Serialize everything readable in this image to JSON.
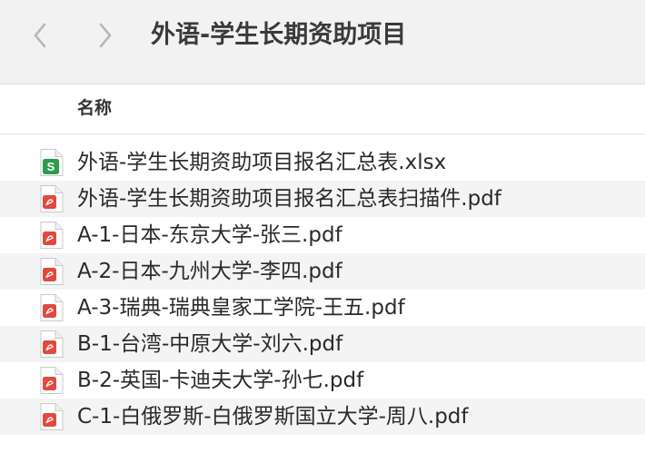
{
  "window": {
    "title": "外语-学生长期资助项目"
  },
  "navigation": {
    "back_icon": "chevron-left-icon",
    "forward_icon": "chevron-right-icon"
  },
  "columns": {
    "name": "名称"
  },
  "colors": {
    "toolbar_bg": "#f2f2f2",
    "row_alt_bg": "#f4f4f4",
    "xlsx_icon_accent": "#2e9b4f",
    "pdf_icon_accent": "#e04a3f"
  },
  "files": [
    {
      "name": "外语-学生长期资助项目报名汇总表.xlsx",
      "icon": "xlsx-file-icon"
    },
    {
      "name": "外语-学生长期资助项目报名汇总表扫描件.pdf",
      "icon": "pdf-file-icon"
    },
    {
      "name": "A-1-日本-东京大学-张三.pdf",
      "icon": "pdf-file-icon"
    },
    {
      "name": "A-2-日本-九州大学-李四.pdf",
      "icon": "pdf-file-icon"
    },
    {
      "name": "A-3-瑞典-瑞典皇家工学院-王五.pdf",
      "icon": "pdf-file-icon"
    },
    {
      "name": "B-1-台湾-中原大学-刘六.pdf",
      "icon": "pdf-file-icon"
    },
    {
      "name": "B-2-英国-卡迪夫大学-孙七.pdf",
      "icon": "pdf-file-icon"
    },
    {
      "name": "C-1-白俄罗斯-白俄罗斯国立大学-周八.pdf",
      "icon": "pdf-file-icon"
    }
  ]
}
